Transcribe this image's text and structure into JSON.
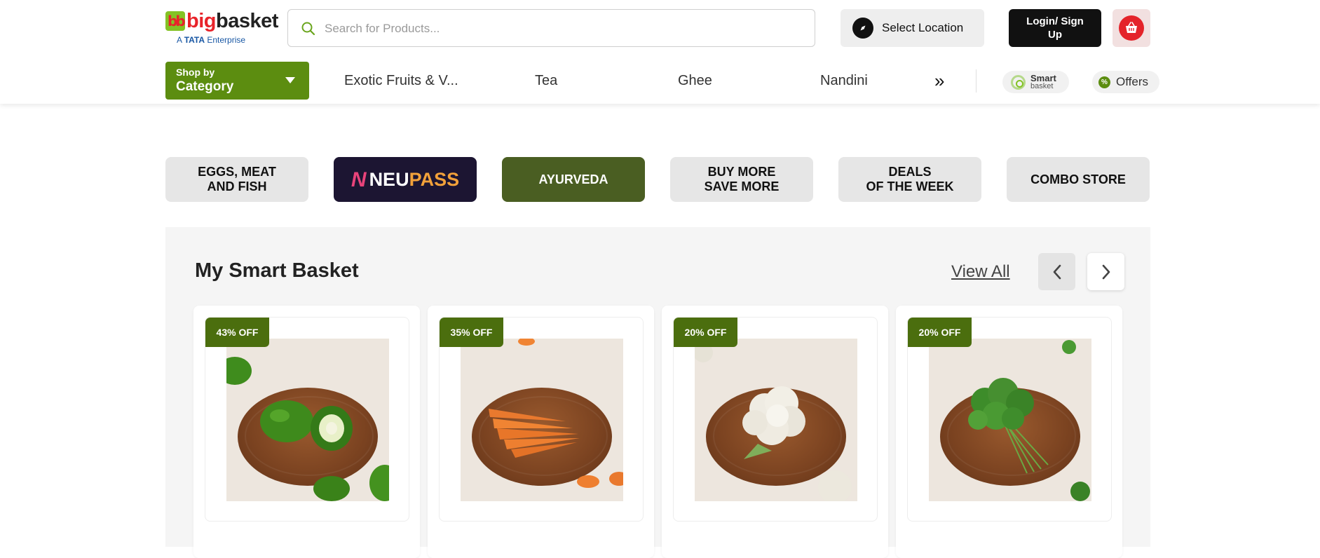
{
  "brand": {
    "logo_mark": "bb",
    "logo_text_prefix": "big",
    "logo_text_suffix": "basket",
    "tagline_prefix": "A",
    "tagline_brand": "TATA",
    "tagline_suffix": "Enterprise"
  },
  "search": {
    "placeholder": "Search for Products..."
  },
  "location": {
    "label": "Select Location"
  },
  "login": {
    "label": "Login/ Sign Up"
  },
  "category": {
    "top": "Shop by",
    "main": "Category"
  },
  "nav_items": [
    "Exotic Fruits & V...",
    "Tea",
    "Ghee",
    "Nandini"
  ],
  "nav_more": "»",
  "smart": {
    "line1": "Smart",
    "line2": "basket"
  },
  "offers": {
    "label": "Offers"
  },
  "tiles": [
    {
      "label": "EGGS, MEAT\nAND FISH"
    },
    {
      "label_n": "N",
      "label_neu": "NEU",
      "label_pass": "PASS"
    },
    {
      "label": "AYURVEDA"
    },
    {
      "label": "BUY MORE\nSAVE MORE"
    },
    {
      "label": "DEALS\nOF THE WEEK"
    },
    {
      "label": "COMBO STORE"
    }
  ],
  "smart_basket": {
    "title": "My Smart Basket",
    "view_all": "View All",
    "products": [
      {
        "badge": "43% OFF",
        "image": "capsicum-image",
        "color": "#3e8a1c"
      },
      {
        "badge": "35% OFF",
        "image": "carrot-image",
        "color": "#e9792e"
      },
      {
        "badge": "20% OFF",
        "image": "cauliflower-image",
        "color": "#efece3"
      },
      {
        "badge": "20% OFF",
        "image": "coriander-image",
        "color": "#3d8c2a"
      }
    ]
  },
  "colors": {
    "brand_green": "#5c8d10",
    "badge_green": "#4b6e0e",
    "brand_red": "#e4232a",
    "ayurveda_bg": "#4a5e22",
    "neupass_bg": "#1c1532"
  }
}
